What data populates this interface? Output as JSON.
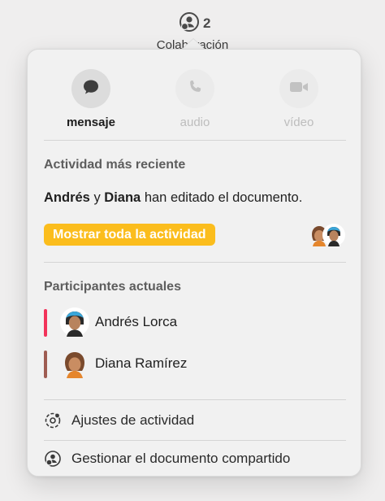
{
  "toolbar": {
    "collab_count": "2",
    "collab_label": "Colaboración"
  },
  "communication": {
    "message_label": "mensaje",
    "audio_label": "audio",
    "video_label": "vídeo"
  },
  "activity": {
    "title": "Actividad más reciente",
    "person1": "Andrés",
    "connector": "y",
    "person2": "Diana",
    "action": "han editado el documento.",
    "show_all_label": "Mostrar toda la actividad"
  },
  "participants": {
    "title": "Participantes actuales",
    "items": [
      {
        "name": "Andrés Lorca",
        "color": "#f2335a"
      },
      {
        "name": "Diana Ramírez",
        "color": "#9e5c52"
      }
    ]
  },
  "menu": {
    "activity_settings": "Ajustes de actividad",
    "manage_shared": "Gestionar el documento compartido"
  },
  "colors": {
    "accent": "#fbbd1d",
    "popover_bg": "#f1f1f1"
  }
}
